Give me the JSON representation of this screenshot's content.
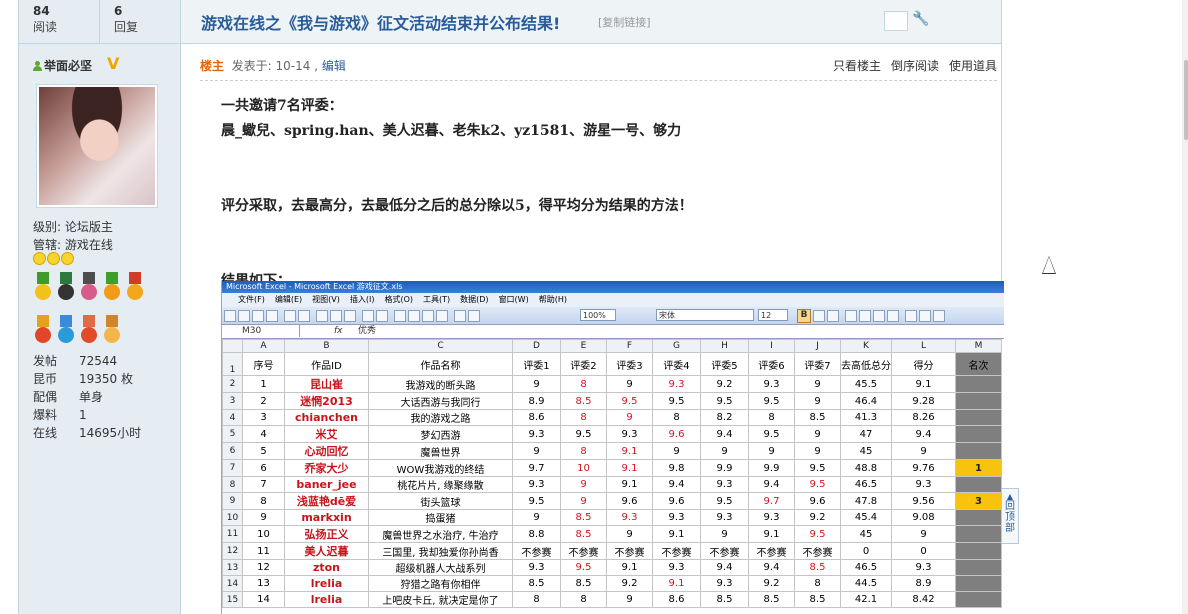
{
  "stats": [
    {
      "num": "84",
      "label": "阅读"
    },
    {
      "num": "6",
      "label": "回复"
    }
  ],
  "user": {
    "name": "举面必坚",
    "level_label": "级别: 论坛版主",
    "manage_label": "管辖: 游戏在线"
  },
  "profile": [
    {
      "k": "发帖",
      "v": "72544"
    },
    {
      "k": "昆币",
      "v": "19350 枚"
    },
    {
      "k": "配偶",
      "v": "单身"
    },
    {
      "k": "爆料",
      "v": "1"
    },
    {
      "k": "在线",
      "v": "14695小时"
    }
  ],
  "post": {
    "title": "游戏在线之《我与游戏》征文活动结束并公布结果!",
    "copy_link": "[复制链接]",
    "op_label": "楼主",
    "posted": "发表于: 10-14 ,",
    "edit": "编辑",
    "actions": [
      "只看楼主",
      "倒序阅读",
      "使用道具"
    ],
    "paragraphs": [
      "一共邀请7名评委：",
      "晨_蠍兒、spring.han、美人迟暮、老朱k2、yz1581、游星一号、够力",
      "",
      "",
      "评分采取，去最高分，去最低分之后的总分除以5，得平均分为结果的方法！",
      "",
      "",
      "结果如下："
    ]
  },
  "excel": {
    "title": "Microsoft Excel - Microsoft Excel 游戏征文.xls",
    "menu": [
      "文件(F)",
      "编辑(E)",
      "视图(V)",
      "插入(I)",
      "格式(O)",
      "工具(T)",
      "数据(D)",
      "窗口(W)",
      "帮助(H)"
    ],
    "zoom": "100%",
    "font": "宋体",
    "size": "12",
    "cell_ref": "M30",
    "fx": "fx",
    "formula_value": "优秀",
    "col_letters": [
      "A",
      "B",
      "C",
      "D",
      "E",
      "F",
      "G",
      "H",
      "I",
      "J",
      "K",
      "L",
      "M"
    ],
    "header": [
      "序号",
      "作品ID",
      "作品名称",
      "评委1",
      "评委2",
      "评委3",
      "评委4",
      "评委5",
      "评委6",
      "评委7",
      "去高低总分",
      "得分",
      "名次"
    ],
    "rows": [
      [
        "1",
        "昆山崔",
        "我游戏的断头路",
        "9",
        "8",
        "9",
        "9.3",
        "9.2",
        "9.3",
        "9",
        "45.5",
        "9.1",
        ""
      ],
      [
        "2",
        "迷惘2013",
        "大话西游与我同行",
        "8.9",
        "8.5",
        "9.5",
        "9.5",
        "9.5",
        "9.5",
        "9",
        "46.4",
        "9.28",
        ""
      ],
      [
        "3",
        "chianchen",
        "我的游戏之路",
        "8.6",
        "8",
        "9",
        "8",
        "8.2",
        "8",
        "8.5",
        "41.3",
        "8.26",
        ""
      ],
      [
        "4",
        "米艾",
        "梦幻西游",
        "9.3",
        "9.5",
        "9.3",
        "9.6",
        "9.4",
        "9.5",
        "9",
        "47",
        "9.4",
        ""
      ],
      [
        "5",
        "心动回忆",
        "魔兽世界",
        "9",
        "8",
        "9.1",
        "9",
        "9",
        "9",
        "9",
        "45",
        "9",
        ""
      ],
      [
        "6",
        "乔家大少",
        "WOW我游戏的终结",
        "9.7",
        "10",
        "9.1",
        "9.8",
        "9.9",
        "9.9",
        "9.5",
        "48.8",
        "9.76",
        "1"
      ],
      [
        "7",
        "baner_jee",
        "桃花片片, 缘聚缘散",
        "9.3",
        "9",
        "9.1",
        "9.4",
        "9.3",
        "9.4",
        "9.5",
        "46.5",
        "9.3",
        ""
      ],
      [
        "8",
        "浅蓝艳dē爱",
        "街头篮球",
        "9.5",
        "9",
        "9.6",
        "9.6",
        "9.5",
        "9.7",
        "9.6",
        "47.8",
        "9.56",
        "3"
      ],
      [
        "9",
        "markxin",
        "捣蛋猪",
        "9",
        "8.5",
        "9.3",
        "9.3",
        "9.3",
        "9.3",
        "9.2",
        "45.4",
        "9.08",
        ""
      ],
      [
        "10",
        "弘扬正义",
        "魔兽世界之水治疗, 牛治疗",
        "8.8",
        "8.5",
        "9",
        "9.1",
        "9",
        "9.1",
        "9.5",
        "45",
        "9",
        ""
      ],
      [
        "11",
        "美人迟暮",
        "三国里, 我却独爱你孙尚香",
        "不参赛",
        "不参赛",
        "不参赛",
        "不参赛",
        "不参赛",
        "不参赛",
        "不参赛",
        "0",
        "0",
        ""
      ],
      [
        "12",
        "zton",
        "超级机器人大战系列",
        "9.3",
        "9.5",
        "9.1",
        "9.3",
        "9.4",
        "9.4",
        "8.5",
        "46.5",
        "9.3",
        ""
      ],
      [
        "13",
        "lrelia",
        "狩猎之路有你相伴",
        "8.5",
        "8.5",
        "9.2",
        "9.1",
        "9.3",
        "9.2",
        "8",
        "44.5",
        "8.9",
        ""
      ],
      [
        "14",
        "lrelia",
        "上吧皮卡丘, 就决定是你了",
        "8",
        "8",
        "9",
        "8.6",
        "8.5",
        "8.5",
        "8.5",
        "42.1",
        "8.42",
        ""
      ]
    ]
  },
  "back_to_top": "回顶部"
}
